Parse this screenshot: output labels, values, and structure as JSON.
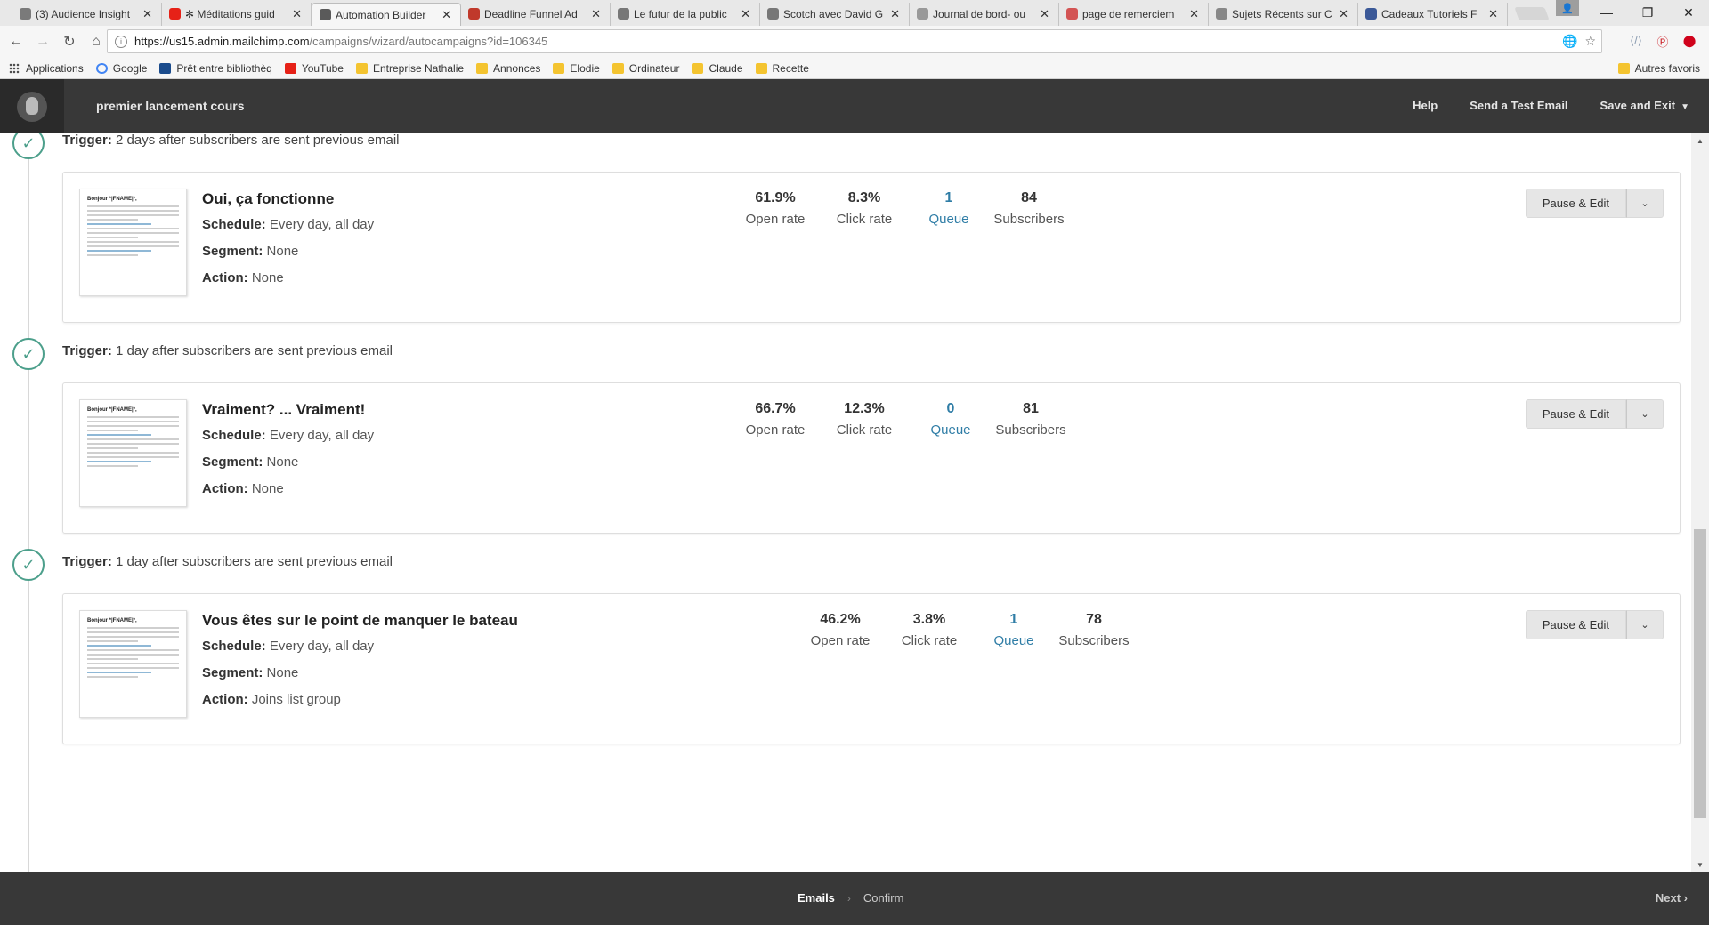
{
  "browser": {
    "tabs": [
      {
        "title": "(3) Audience Insight",
        "color": "#7a7a7a"
      },
      {
        "title": "✻ Méditations guid",
        "color": "#e62117"
      },
      {
        "title": "Automation Builder",
        "color": "#5a5a5a"
      },
      {
        "title": "Deadline Funnel Ad",
        "color": "#c0392b"
      },
      {
        "title": "Le futur de la public",
        "color": "#777777"
      },
      {
        "title": "Scotch avec David G",
        "color": "#777777"
      },
      {
        "title": "Journal de bord- ou",
        "color": "#999999"
      },
      {
        "title": "page de remerciem",
        "color": "#d35454"
      },
      {
        "title": "Sujets Récents sur C",
        "color": "#888888"
      },
      {
        "title": "Cadeaux Tutoriels F",
        "color": "#3b5998"
      }
    ],
    "active_tab_index": 2,
    "close_glyph": "✕",
    "url_host": "https://us15.admin.mailchimp.com",
    "url_path": "/campaigns/wizard/autocampaigns?id=106345",
    "bookmarks": [
      {
        "label": "Applications",
        "type": "apps"
      },
      {
        "label": "Google",
        "type": "google"
      },
      {
        "label": "Prêt entre bibliothèq",
        "type": "site"
      },
      {
        "label": "YouTube",
        "type": "youtube"
      },
      {
        "label": "Entreprise Nathalie",
        "type": "folder"
      },
      {
        "label": "Annonces",
        "type": "folder"
      },
      {
        "label": "Elodie",
        "type": "folder"
      },
      {
        "label": "Ordinateur",
        "type": "folder"
      },
      {
        "label": "Claude",
        "type": "folder"
      },
      {
        "label": "Recette",
        "type": "folder"
      }
    ],
    "other_bookmarks": "Autres favoris"
  },
  "header": {
    "campaign_name": "premier lancement cours",
    "help": "Help",
    "test_email": "Send a Test Email",
    "save_exit": "Save and Exit"
  },
  "labels": {
    "trigger": "Trigger:",
    "schedule": "Schedule:",
    "segment": "Segment:",
    "action": "Action:",
    "open_rate": "Open rate",
    "click_rate": "Click rate",
    "queue": "Queue",
    "subscribers": "Subscribers",
    "pause_edit": "Pause & Edit"
  },
  "emails": [
    {
      "trigger": "2 days after subscribers are sent previous email",
      "title": "Oui, ça fonctionne",
      "schedule": "Every day, all day",
      "segment": "None",
      "action": "None",
      "open_rate": "61.9%",
      "click_rate": "8.3%",
      "queue": "1",
      "subscribers": "84",
      "thumb_heading": "Bonjour *|FNAME|*,"
    },
    {
      "trigger": "1 day after subscribers are sent previous email",
      "title": "Vraiment? ... Vraiment!",
      "schedule": "Every day, all day",
      "segment": "None",
      "action": "None",
      "open_rate": "66.7%",
      "click_rate": "12.3%",
      "queue": "0",
      "subscribers": "81",
      "thumb_heading": "Bonjour *|FNAME|*,"
    },
    {
      "trigger": "1 day after subscribers are sent previous email",
      "title": "Vous êtes sur le point de manquer le bateau",
      "schedule": "Every day, all day",
      "segment": "None",
      "action": "Joins list group",
      "open_rate": "46.2%",
      "click_rate": "3.8%",
      "queue": "1",
      "subscribers": "78",
      "thumb_heading": "Bonjour *|FNAME|*,"
    }
  ],
  "footer": {
    "step_current": "Emails",
    "step_next": "Confirm",
    "next": "Next"
  },
  "colors": {
    "header_bg": "#383838",
    "accent_teal": "#4c9f8b",
    "link_blue": "#2f7da6"
  },
  "icons": {
    "check": "✓",
    "chevron": "⌄",
    "chevron_right": "›"
  }
}
